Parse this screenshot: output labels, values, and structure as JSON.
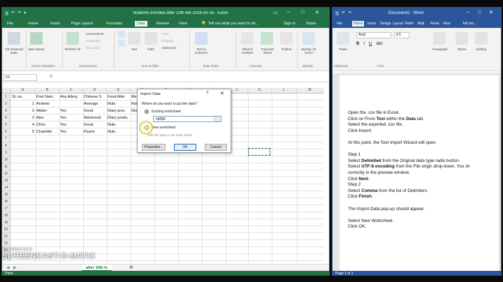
{
  "excel": {
    "title": "Students enrolled after 10th feb 2016-03-18 - Excel",
    "tabs": [
      "File",
      "Home",
      "Insert",
      "Page Layout",
      "Formulas",
      "Data",
      "Review",
      "View"
    ],
    "tell_me": "Tell me what you want to do...",
    "sign_in": "Sign in",
    "share": "Share",
    "ribbon": {
      "get_external": "Get External Data",
      "new_query": "New Query",
      "refresh_all": "Refresh All",
      "connections": "Connections",
      "properties": "Properties",
      "edit_links": "Edit Links",
      "sort": "Sort",
      "filter": "Filter",
      "clear": "Clear",
      "reapply": "Reapply",
      "advanced": "Advanced",
      "text_to_columns": "Text to Columns",
      "what_if": "What-If Analysis",
      "forecast_sheet": "Forecast Sheet",
      "outline": "Outline",
      "mysql": "MySQL for Excel",
      "grp_get": "Get & Transform",
      "grp_conn": "Connections",
      "grp_sort": "Sort & Filter",
      "grp_tools": "Data Tools",
      "grp_forecast": "Forecast",
      "grp_mysql": "MySQL"
    },
    "name_box": "K8",
    "columns": [
      "A",
      "B",
      "C",
      "D",
      "E",
      "F",
      "G",
      "H",
      "I",
      "J",
      "K",
      "L",
      "M"
    ],
    "rows": [
      "1",
      "2",
      "3",
      "4",
      "5",
      "6",
      "7",
      "8",
      "9",
      "10",
      "11",
      "12",
      "13",
      "14",
      "15",
      "16",
      "17",
      "18",
      "19",
      "20",
      "21",
      "22",
      "23",
      "24"
    ],
    "headers": [
      "Sl. no.",
      "First Nam",
      "Any Allerg",
      "Chinese S",
      "Food Aller",
      "Me"
    ],
    "data": [
      [
        "1",
        "Andrew",
        "",
        "Average",
        "Nuts",
        "Nor"
      ],
      [
        "2",
        "Alister",
        "Yes",
        "Good",
        "Diary proc",
        "Nor"
      ],
      [
        "3",
        "Alex",
        "Yes",
        "Advanced",
        "Diary produ",
        ""
      ],
      [
        "4",
        "Chris",
        "Yes",
        "Good",
        "Nuts",
        ""
      ],
      [
        "5",
        "Charlotte",
        "Yes",
        "Fluent",
        "Nuts",
        ""
      ]
    ],
    "sheet_tab": "after 10th fe",
    "status": "Point"
  },
  "dialog": {
    "title": "Import Data",
    "help": "?",
    "question": "Where do you want to put the data?",
    "existing": "Existing worksheet:",
    "range": "=$A$8",
    "new_ws": "New worksheet",
    "add_model": "Add this data to the Data Model",
    "properties": "Properties...",
    "ok": "OK",
    "cancel": "Cancel"
  },
  "watermark": {
    "line1": "RECORDED WITH",
    "line2": "SCREENCAST-O-MATIC"
  },
  "word": {
    "title": "Document1 - Word",
    "tabs": [
      "File",
      "Home",
      "Insert",
      "Design",
      "Layout",
      "Refer",
      "Mail",
      "Revie",
      "View"
    ],
    "tell_me": "Tell me...",
    "ribbon": {
      "paste": "Paste",
      "font": "Arial",
      "size": "9.5",
      "paragraph": "Paragraph",
      "styles": "Styles",
      "editing": "Editing",
      "grp_clip": "Clipboard",
      "grp_font": "Font"
    },
    "lines": [
      {
        "text": "Open the .csv file in Excel."
      },
      {
        "pre": "Click on From ",
        "b": "Text",
        "mid": " within the ",
        "b2": "Data",
        "post": " tab."
      },
      {
        "text": "Select the exported .csv file."
      },
      {
        "text": "Click Import."
      },
      {
        "text": ""
      },
      {
        "text": "At this point, the Text Import Wizard will open."
      },
      {
        "text": ""
      },
      {
        "text": "Step 1"
      },
      {
        "pre": "Select ",
        "b": "Delimited",
        "post": " from the Original data type radio button."
      },
      {
        "pre": "Select ",
        "b": "UTF-8 encoding",
        "post": " from the File origin drop-down.  You sh"
      },
      {
        "text": "correctly in the preview window."
      },
      {
        "pre": "Click ",
        "b": "Next",
        "post": "."
      },
      {
        "text": "Step 2"
      },
      {
        "pre": "Select ",
        "b": "Comma",
        "post": " from the list of Delimiters."
      },
      {
        "pre": "Click ",
        "b": "Finish",
        "post": "."
      },
      {
        "text": ""
      },
      {
        "text": "The Import Data pop-up should appear."
      },
      {
        "text": ""
      },
      {
        "text": "Select New Worksheet."
      },
      {
        "text": "Click OK."
      }
    ],
    "status": "Page 1 of 1"
  }
}
